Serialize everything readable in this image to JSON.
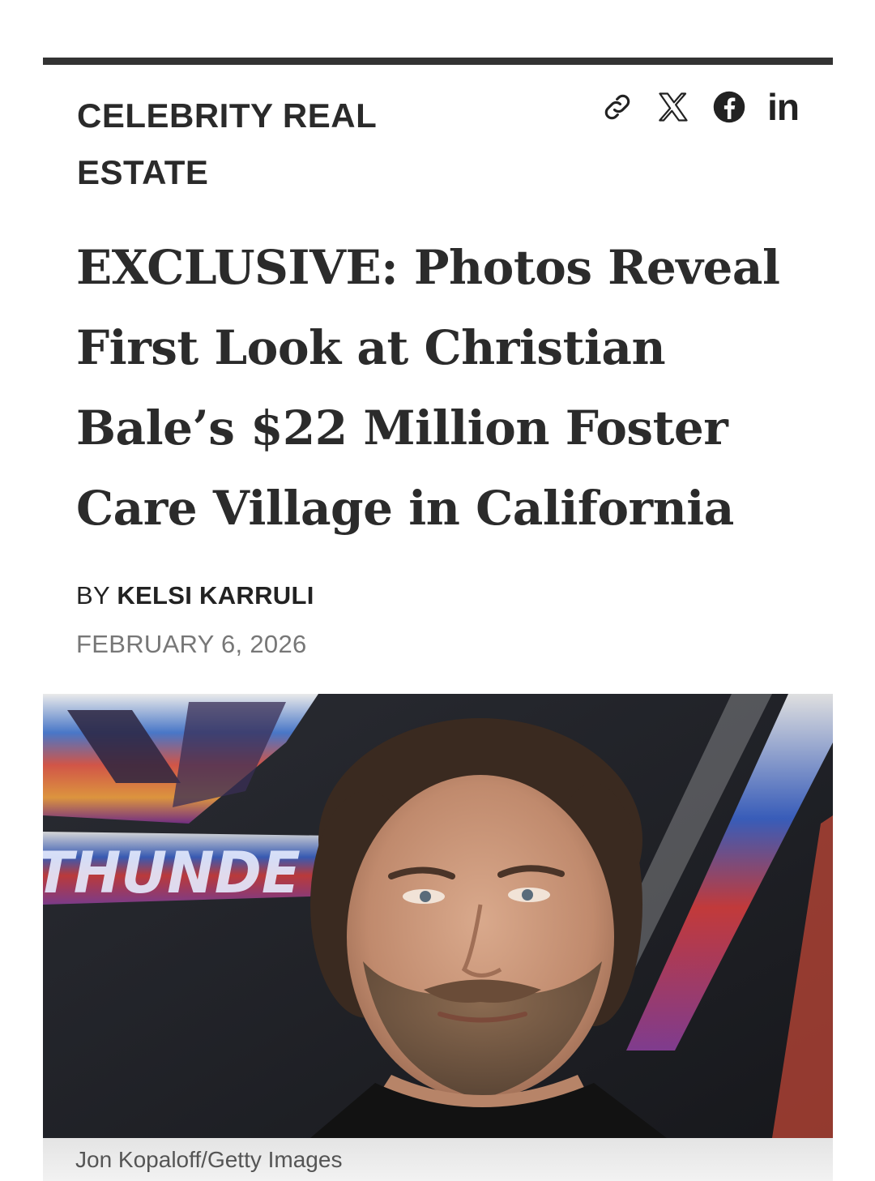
{
  "article": {
    "category": "CELEBRITY REAL ESTATE",
    "headline": "EXCLUSIVE: Photos Reveal First Look at Christian Bale’s $22 Million Foster Care Village in California",
    "byline_prefix": "BY",
    "author": "KELSI KARRULI",
    "date": "FEBRUARY 6, 2026"
  },
  "share": {
    "icons": [
      "link-icon",
      "x-icon",
      "facebook-icon",
      "linkedin-icon"
    ],
    "linkedin_text": "in"
  },
  "photo": {
    "backdrop_text": "THUNDE",
    "caption": "Jon Kopaloff/Getty Images"
  },
  "colors": {
    "text": "#222222",
    "date": "#777777",
    "rule": "#333333",
    "caption_bg": "#e9e9e9"
  }
}
